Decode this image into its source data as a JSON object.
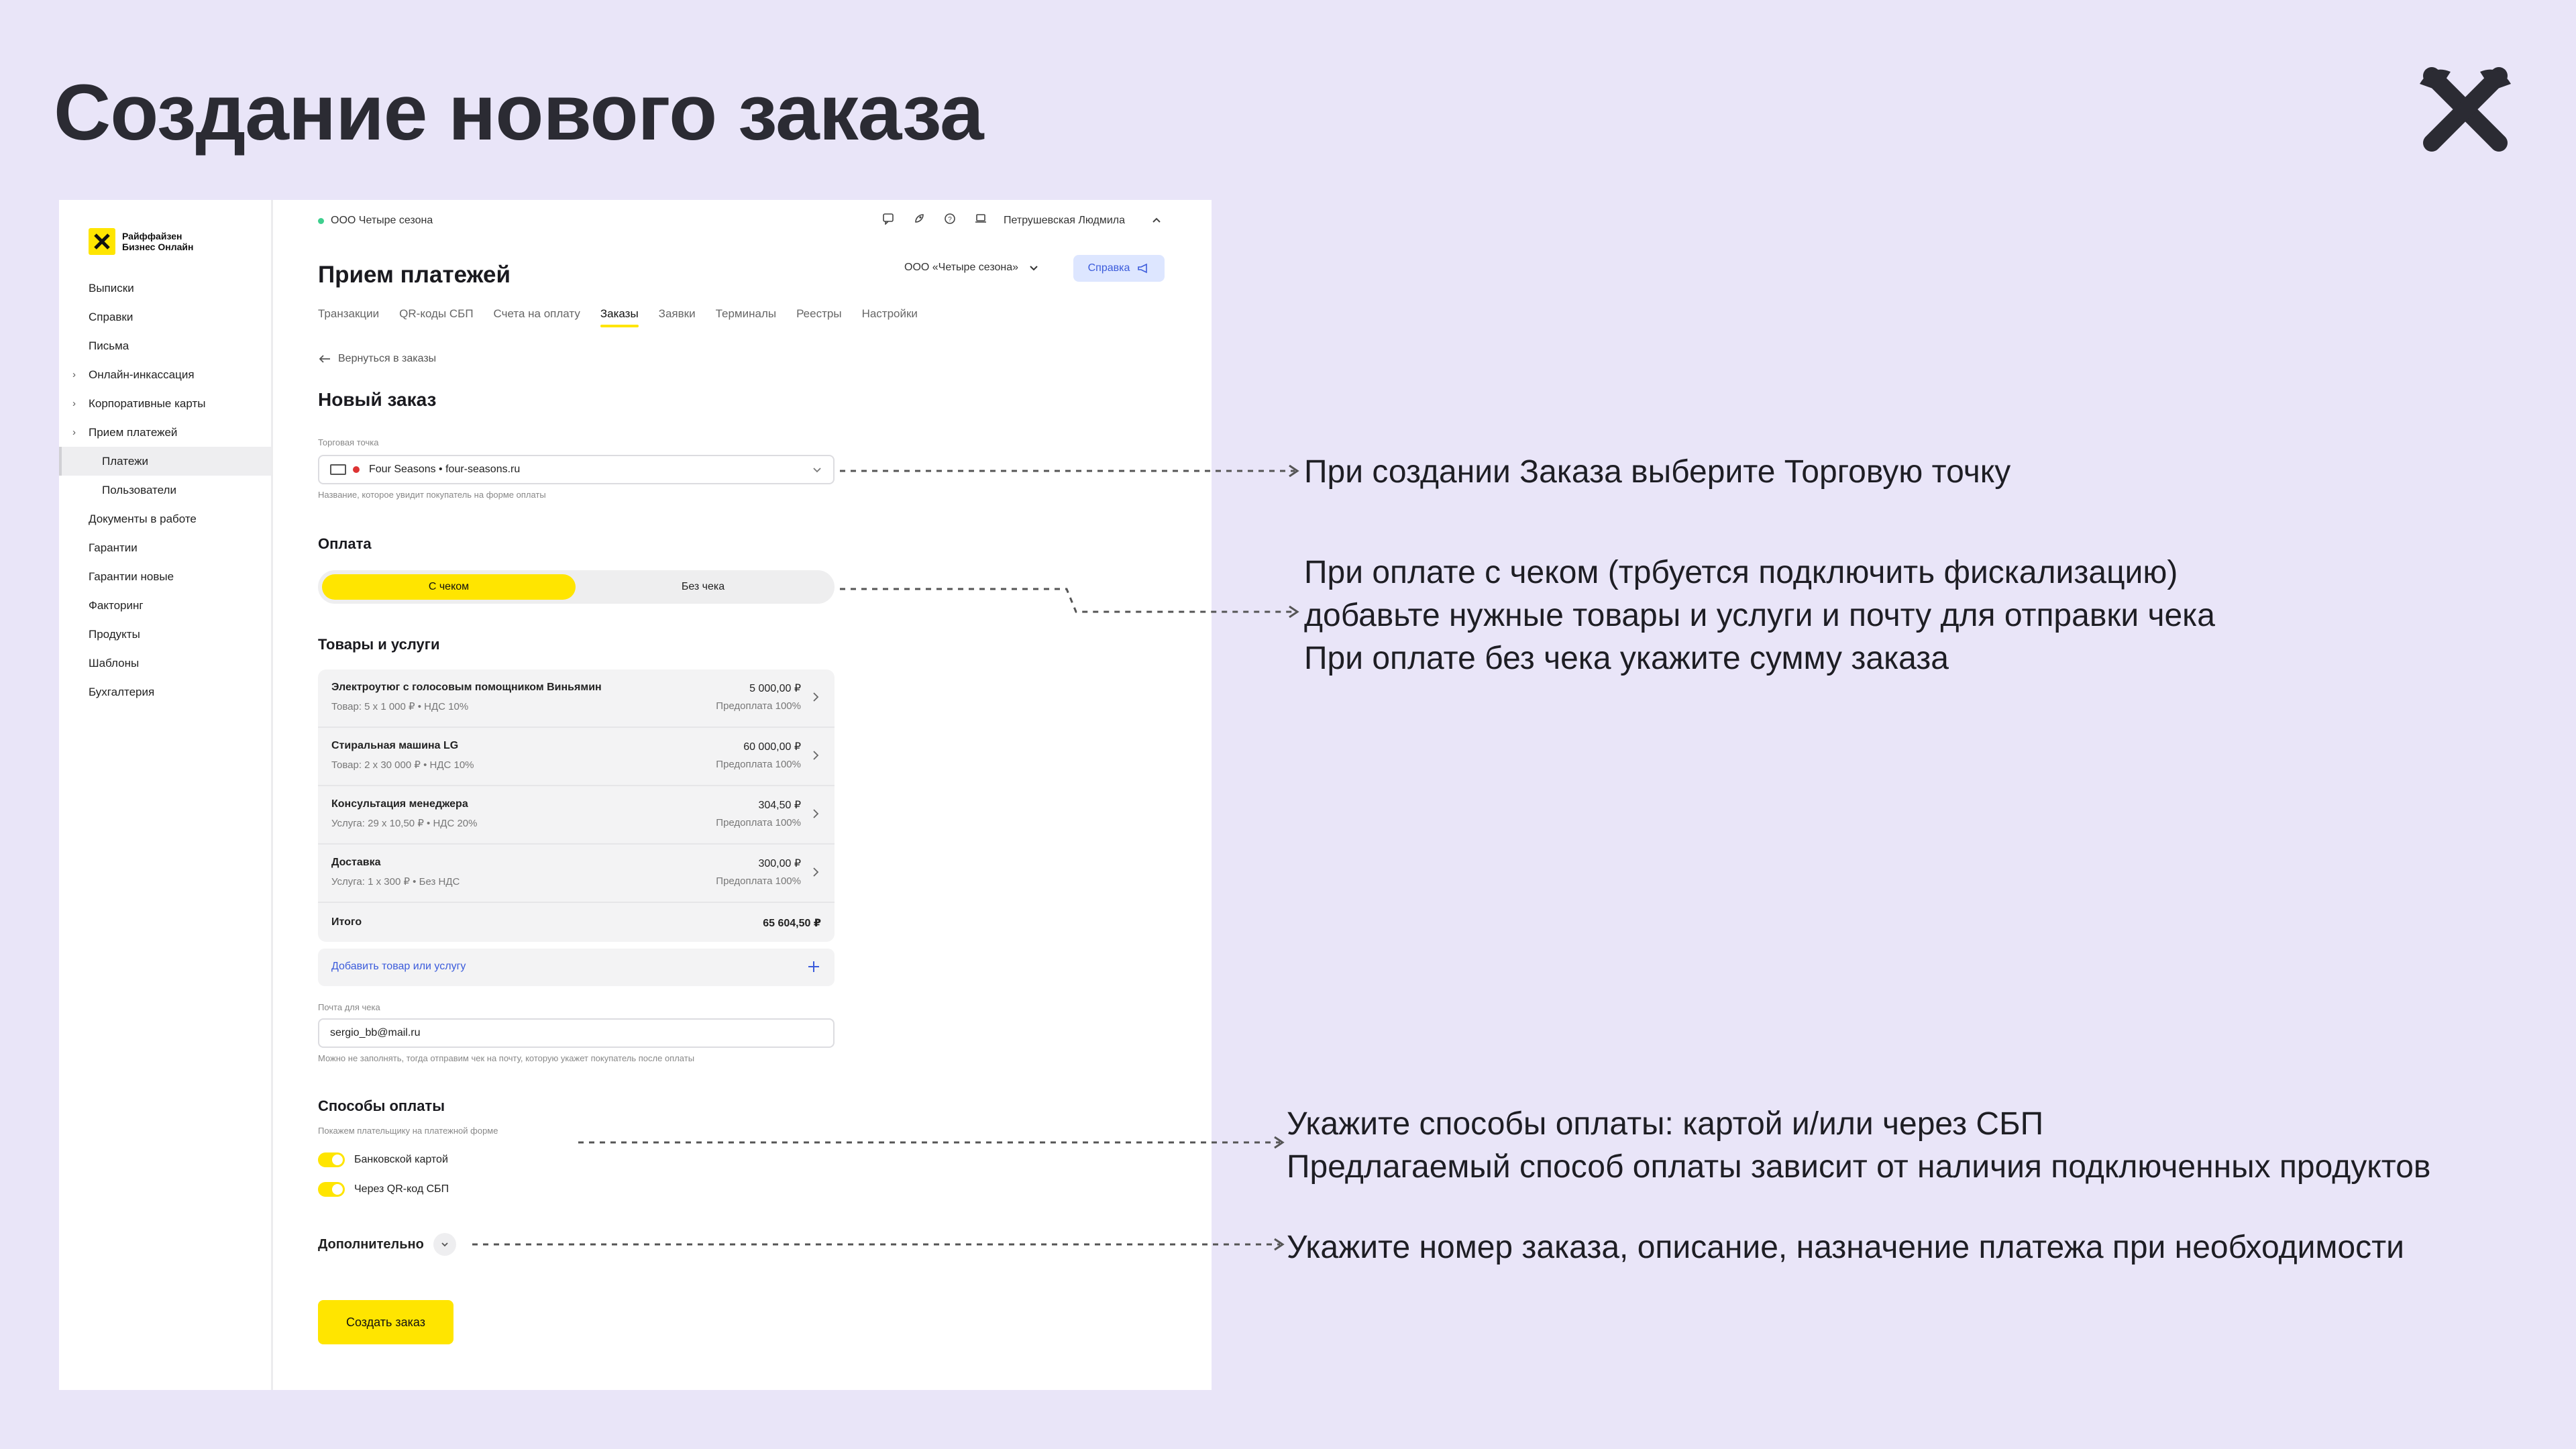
{
  "slide": {
    "title": "Создание нового заказа"
  },
  "sidebar": {
    "brand": "Райффайзен Бизнес Онлайн",
    "items": [
      {
        "label": "Выписки"
      },
      {
        "label": "Справки"
      },
      {
        "label": "Письма"
      },
      {
        "label": "Онлайн-инкассация"
      },
      {
        "label": "Корпоративные карты"
      },
      {
        "label": "Прием платежей"
      },
      {
        "label": "Платежи"
      },
      {
        "label": "Пользователи"
      },
      {
        "label": "Документы в работе"
      },
      {
        "label": "Гарантии"
      },
      {
        "label": "Гарантии новые"
      },
      {
        "label": "Факторинг"
      },
      {
        "label": "Продукты"
      },
      {
        "label": "Шаблоны"
      },
      {
        "label": "Бухгалтерия"
      }
    ]
  },
  "topbar": {
    "org": "ООО Четыре сезона",
    "user": "Петрушевская Людмила"
  },
  "header": {
    "title": "Прием платежей",
    "org_select": "ООО «Четыре сезона»",
    "help_label": "Справка",
    "tabs": [
      {
        "label": "Транзакции"
      },
      {
        "label": "QR-коды СБП"
      },
      {
        "label": "Счета на оплату"
      },
      {
        "label": "Заказы"
      },
      {
        "label": "Заявки"
      },
      {
        "label": "Терминалы"
      },
      {
        "label": "Реестры"
      },
      {
        "label": "Настройки"
      }
    ]
  },
  "form": {
    "back_label": "Вернуться в заказы",
    "title": "Новый заказ",
    "store_label": "Торговая точка",
    "store_value": "Four Seasons • four-seasons.ru",
    "store_hint": "Название, которое увидит покупатель на форме оплаты",
    "payment_title": "Оплата",
    "seg_with_receipt": "С чеком",
    "seg_without_receipt": "Без чека",
    "goods_title": "Товары и услуги",
    "items": [
      {
        "name": "Электроутюг с голосовым помощником Виньямин",
        "sub": "Товар:  5 x 1 000 ₽  •  НДС 10%",
        "price": "5 000,00 ₽",
        "prepay": "Предоплата 100%"
      },
      {
        "name": "Стиральная машина LG",
        "sub": "Товар:  2 x 30 000 ₽  •  НДС 10%",
        "price": "60 000,00 ₽",
        "prepay": "Предоплата 100%"
      },
      {
        "name": "Консультация менеджера",
        "sub": "Услуга:  29 x 10,50 ₽  •  НДС 20%",
        "price": "304,50 ₽",
        "prepay": "Предоплата 100%"
      },
      {
        "name": "Доставка",
        "sub": "Услуга:  1 x 300 ₽  •  Без НДС",
        "price": "300,00 ₽",
        "prepay": "Предоплата 100%"
      }
    ],
    "total_label": "Итого",
    "total_value": "65 604,50 ₽",
    "add_label": "Добавить товар или услугу",
    "email_label": "Почта для чека",
    "email_value": "sergio_bb@mail.ru",
    "email_hint": "Можно не заполнять, тогда отправим чек на почту, которую укажет покупатель после оплаты",
    "methods_title": "Способы оплаты",
    "methods_hint": "Покажем плательщику на платежной форме",
    "method_card": "Банковской картой",
    "method_sbp": "Через QR-код СБП",
    "extra_label": "Дополнительно",
    "create_label": "Создать заказ"
  },
  "callouts": {
    "store": "При создании Заказа выберите Торговую точку",
    "receipt_1": "При оплате с чеком (трбуется подключить фискализацию)",
    "receipt_2": "добавьте нужные товары и услуги и почту для отправки чека",
    "receipt_3": "При оплате без чека укажите сумму заказа",
    "methods_1": "Укажите способы оплаты: картой и/или через СБП",
    "methods_2": "Предлагаемый способ оплаты зависит от наличия подключенных продуктов",
    "extra": "Укажите номер заказа, описание, назначение платежа при необходимости"
  }
}
